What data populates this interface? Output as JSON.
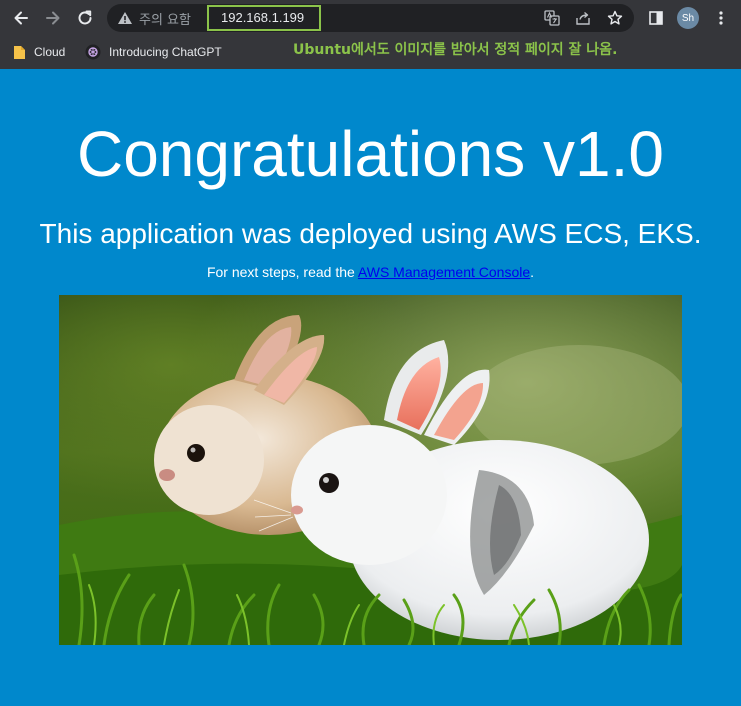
{
  "browser": {
    "security_label": "주의 요함",
    "url": "192.168.1.199",
    "avatar_initials": "Sh",
    "bookmarks": [
      {
        "label": "Cloud",
        "icon": "folder-icon"
      },
      {
        "label": "Introducing ChatGPT",
        "icon": "openai-icon"
      }
    ],
    "annotation": "Ubuntu에서도 이미지를 받아서 정적 페이지 잘 나옴."
  },
  "page": {
    "headline": "Congratulations v1.0",
    "subheadline": "This application was deployed using AWS ECS, EKS.",
    "steps_prefix": "For next steps, read the ",
    "steps_link": "AWS Management Console",
    "steps_suffix": ".",
    "image_subject": "two-rabbits-photo"
  },
  "colors": {
    "page_background": "#0088cc",
    "browser_chrome": "#35363a",
    "omnibox": "#202124",
    "annotation_green": "#8bc34a",
    "link": "#0000ee"
  }
}
